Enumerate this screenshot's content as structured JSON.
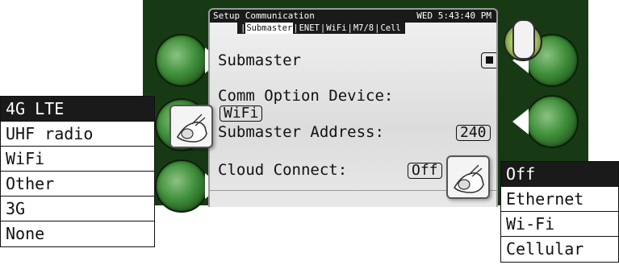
{
  "screen": {
    "title": "Setup Communication",
    "datetime": "WED 5:43:40 PM",
    "tabs": [
      {
        "label": "Submaster",
        "active": true
      },
      {
        "label": "ENET",
        "active": false
      },
      {
        "label": "WiFi",
        "active": false
      },
      {
        "label": "M7/8",
        "active": false
      },
      {
        "label": "Cell",
        "active": false
      }
    ],
    "submaster_label": "Submaster",
    "submaster_checked": true,
    "comm_option_label": "Comm Option Device:",
    "comm_option_value": "WiFi",
    "address_label": "Submaster Address:",
    "address_value": "240",
    "cloud_label": "Cloud Connect:",
    "cloud_value": "Off"
  },
  "comm_device_options": {
    "selected": "4G LTE",
    "items": [
      "4G LTE",
      "UHF radio",
      "WiFi",
      "Other",
      "3G",
      "None"
    ]
  },
  "cloud_options": {
    "selected": "Off",
    "items": [
      "Off",
      "Ethernet",
      "Wi-Fi",
      "Cellular"
    ]
  },
  "colors": {
    "panel": "#173a14",
    "button_green": "#3f8f3a",
    "screen_bg": "#e4e4e4",
    "title_bg": "#1a1a1a"
  },
  "icons": {
    "pointing_hand": "pointing-hand-icon",
    "knob": "scroll-knob-icon"
  }
}
